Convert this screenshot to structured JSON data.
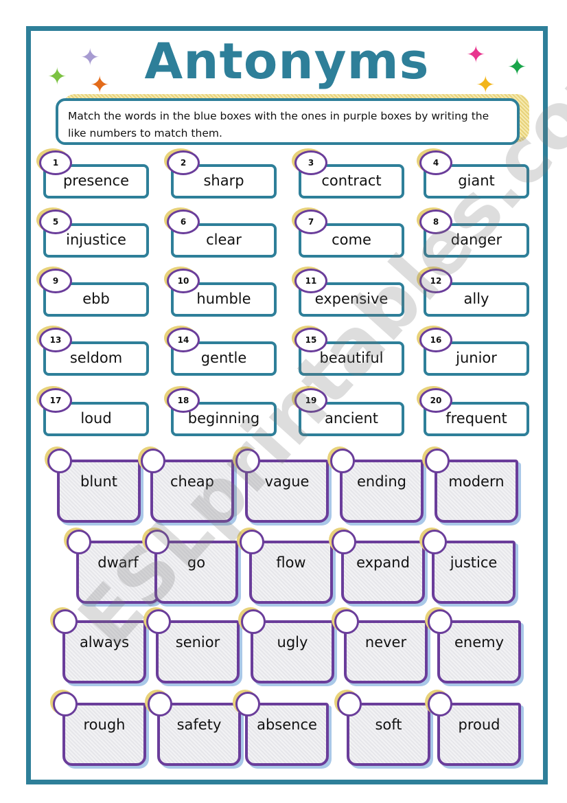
{
  "title": "Antonyms",
  "instructions": "Match the words in the blue boxes with the ones in purple boxes by writing the like numbers to match them.",
  "watermark": "ESLprintables.com",
  "blue_words": [
    {
      "num": "1",
      "word": "presence"
    },
    {
      "num": "2",
      "word": "sharp"
    },
    {
      "num": "3",
      "word": "contract"
    },
    {
      "num": "4",
      "word": "giant"
    },
    {
      "num": "5",
      "word": "injustice"
    },
    {
      "num": "6",
      "word": "clear"
    },
    {
      "num": "7",
      "word": "come"
    },
    {
      "num": "8",
      "word": "danger"
    },
    {
      "num": "9",
      "word": "ebb"
    },
    {
      "num": "10",
      "word": "humble"
    },
    {
      "num": "11",
      "word": "expensive"
    },
    {
      "num": "12",
      "word": "ally"
    },
    {
      "num": "13",
      "word": "seldom"
    },
    {
      "num": "14",
      "word": "gentle"
    },
    {
      "num": "15",
      "word": "beautiful"
    },
    {
      "num": "16",
      "word": "junior"
    },
    {
      "num": "17",
      "word": "loud"
    },
    {
      "num": "18",
      "word": "beginning"
    },
    {
      "num": "19",
      "word": "ancient"
    },
    {
      "num": "20",
      "word": "frequent"
    }
  ],
  "purple_words": [
    "blunt",
    "cheap",
    "vague",
    "ending",
    "modern",
    "dwarf",
    "go",
    "flow",
    "expand",
    "justice",
    "always",
    "senior",
    "ugly",
    "never",
    "enemy",
    "rough",
    "safety",
    "absence",
    "soft",
    "proud"
  ],
  "colors": {
    "teal": "#2e7f99",
    "purple": "#6a3d9a",
    "gold": "#e8d27a"
  }
}
